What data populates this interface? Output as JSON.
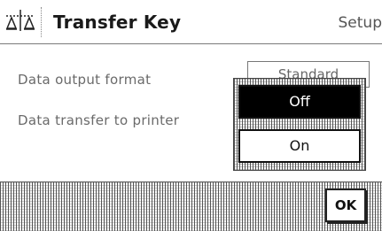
{
  "header": {
    "icon": "balance-scale-icon",
    "title": "Transfer Key",
    "section": "Setup"
  },
  "settings": [
    {
      "label": "Data output format",
      "value": "Standard"
    },
    {
      "label": "Data transfer to printer"
    }
  ],
  "popup": {
    "options": [
      {
        "label": "Off",
        "selected": true
      },
      {
        "label": "On",
        "selected": false
      }
    ]
  },
  "footer": {
    "ok_label": "OK"
  }
}
